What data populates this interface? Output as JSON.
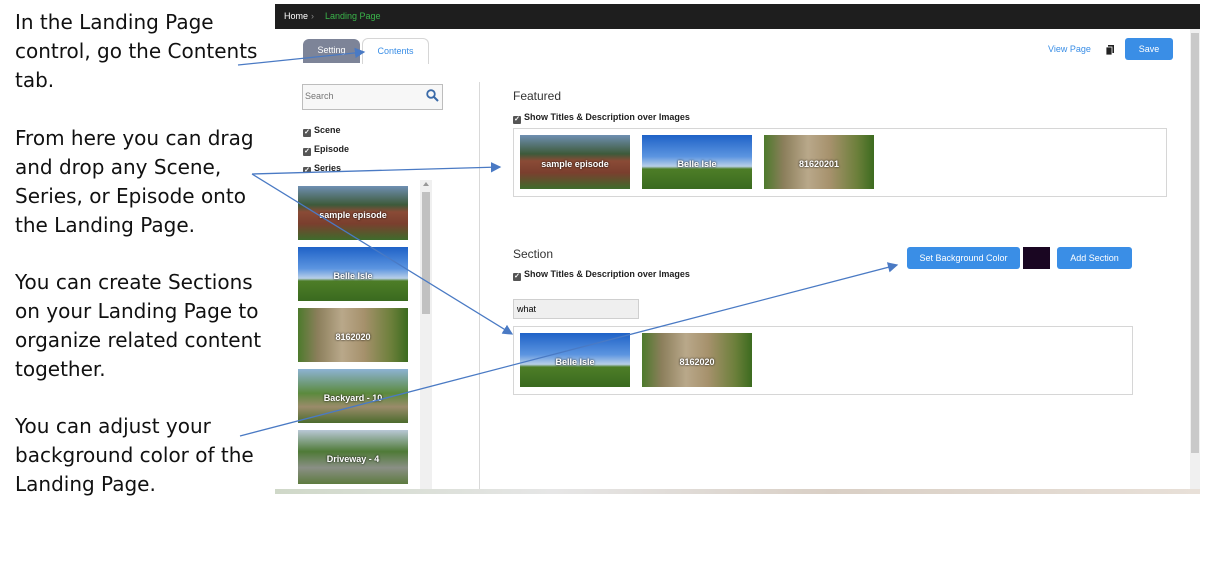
{
  "annotations": [
    {
      "lines": [
        "In the Landing Page",
        "control, go the Contents",
        "tab."
      ]
    },
    {
      "lines": [
        "From here you can drag",
        "and drop any Scene,",
        "Series, or Episode onto",
        "the Landing Page."
      ]
    },
    {
      "lines": [
        "You can create Sections",
        "on your Landing Page to",
        "organize related content",
        "together."
      ]
    },
    {
      "lines": [
        "You can adjust your",
        "background color of the",
        "Landing Page."
      ]
    }
  ],
  "breadcrumb": {
    "home": "Home",
    "separator": "›",
    "current": "Landing Page",
    "current_color": "#3ab54a"
  },
  "tabs": {
    "setting": "Setting",
    "contents": "Contents"
  },
  "header": {
    "view_page": "View Page",
    "save": "Save"
  },
  "sidebar": {
    "search_placeholder": "Search",
    "filters": [
      {
        "label": "Scene",
        "checked": true
      },
      {
        "label": "Episode",
        "checked": true
      },
      {
        "label": "Series",
        "checked": true
      }
    ],
    "items": [
      {
        "title": "sample episode",
        "style": "house"
      },
      {
        "title": "Belle Isle",
        "style": "sky"
      },
      {
        "title": "8162020",
        "style": "fountain"
      },
      {
        "title": "Backyard - 10",
        "style": "yard"
      },
      {
        "title": "Driveway - 4",
        "style": "drive"
      }
    ]
  },
  "featured": {
    "heading": "Featured",
    "show_titles_label": "Show Titles & Description over Images",
    "items": [
      {
        "title": "sample episode",
        "style": "house"
      },
      {
        "title": "Belle Isle",
        "style": "sky"
      },
      {
        "title": "81620201",
        "style": "fountain"
      }
    ]
  },
  "section": {
    "heading": "Section",
    "show_titles_label": "Show Titles & Description over Images",
    "name_value": "what",
    "set_bg_label": "Set Background Color",
    "bg_color": "#1a0622",
    "add_section_label": "Add Section",
    "items": [
      {
        "title": "Belle Isle",
        "style": "sky"
      },
      {
        "title": "8162020",
        "style": "fountain"
      }
    ]
  },
  "colors": {
    "accent": "#3a8ee6",
    "arrow": "#4a7ac4"
  }
}
